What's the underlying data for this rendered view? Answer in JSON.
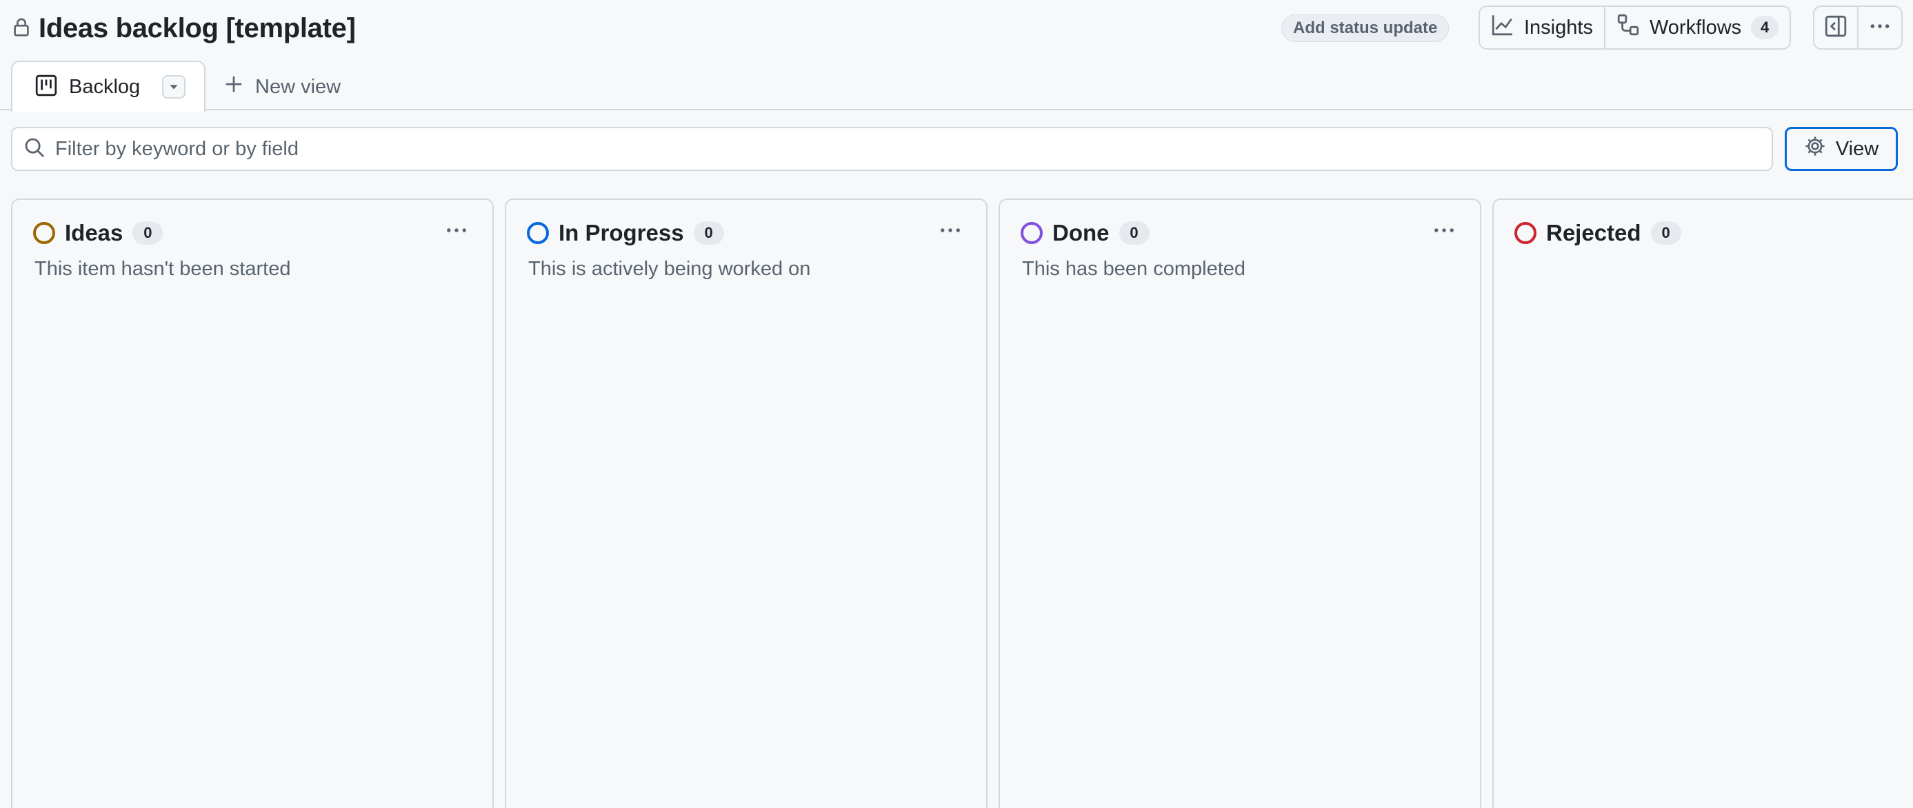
{
  "header": {
    "title": "Ideas backlog [template]",
    "status_update_label": "Add status update",
    "insights_label": "Insights",
    "workflows_label": "Workflows",
    "workflows_count": "4"
  },
  "tabs": {
    "active_label": "Backlog",
    "new_view_label": "New view"
  },
  "filter": {
    "placeholder": "Filter by keyword or by field",
    "value": ""
  },
  "view_button_label": "View",
  "columns": [
    {
      "name": "Ideas",
      "count": "0",
      "description": "This item hasn't been started",
      "color": "#9a6700"
    },
    {
      "name": "In Progress",
      "count": "0",
      "description": "This is actively being worked on",
      "color": "#0969da"
    },
    {
      "name": "Done",
      "count": "0",
      "description": "This has been completed",
      "color": "#8250df"
    },
    {
      "name": "Rejected",
      "count": "0",
      "description": "",
      "color": "#cf222e"
    }
  ],
  "icons": {
    "lock": "lock-icon",
    "insights": "graph-icon",
    "workflows": "workflow-icon",
    "sidebar": "sidebar-expand-icon",
    "more": "kebab-horizontal-icon",
    "board": "project-board-icon",
    "caret": "triangle-down-icon",
    "plus": "plus-icon",
    "search": "search-icon",
    "gear": "gear-icon"
  }
}
